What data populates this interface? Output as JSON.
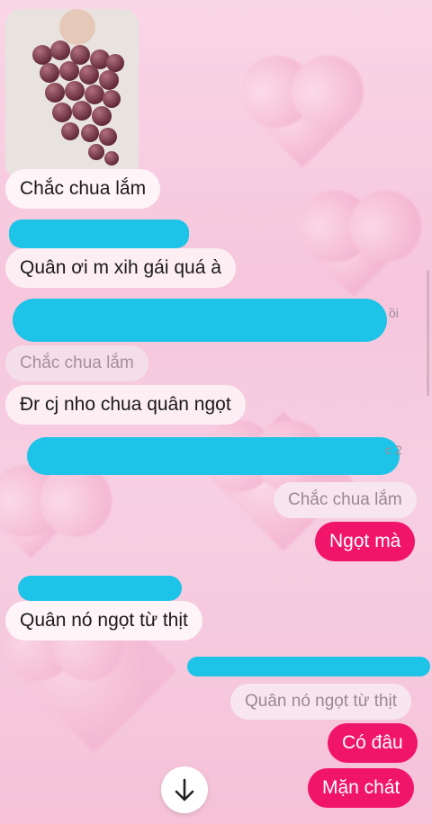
{
  "messages": {
    "m1": "Chắc chua lắm",
    "m2": "Quân ơi m xih gái quá à",
    "m3_reply_quote": "Chắc chua lắm",
    "m3": "Đr cj nho chua quân ngọt",
    "m4_reply_quote": "Chắc chua lắm",
    "m4": "Ngọt mà",
    "m5": "Quân nó ngọt từ thịt",
    "m6_reply_quote": "Quân nó ngọt từ thịt",
    "m6a": "Có đâu",
    "m6b": "Mặn chát"
  },
  "meta": {
    "partial1": "ồi",
    "partial2": "c 2"
  },
  "icons": {
    "scroll_down": "arrow-down-icon"
  },
  "colors": {
    "outgoing_bubble": "#f0156a",
    "redaction": "#1ec4e8"
  }
}
